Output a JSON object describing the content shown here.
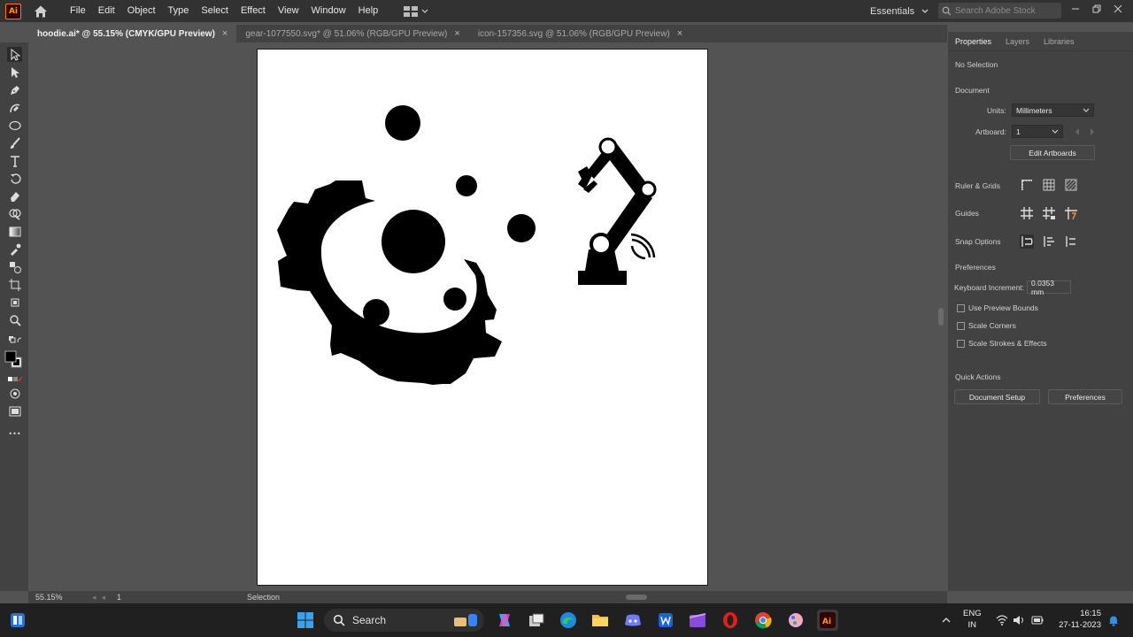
{
  "app": {
    "logo": "Ai",
    "brand_color": "#ff9a00"
  },
  "menu": {
    "items": [
      "File",
      "Edit",
      "Object",
      "Type",
      "Select",
      "Effect",
      "View",
      "Window",
      "Help"
    ],
    "workspace": "Essentials",
    "stock_search_placeholder": "Search Adobe Stock"
  },
  "tabs": [
    {
      "label": "hoodie.ai* @ 55.15% (CMYK/GPU Preview)",
      "active": true
    },
    {
      "label": "gear-1077550.svg* @ 51.06% (RGB/GPU Preview)",
      "active": false
    },
    {
      "label": "icon-157356.svg @ 51.06% (RGB/GPU Preview)",
      "active": false
    }
  ],
  "tab_close_glyph": "×",
  "toolbar": {
    "tools": [
      "selection-tool",
      "direct-selection-tool",
      "pen-tool",
      "curvature-tool",
      "ellipse-tool",
      "paintbrush-tool",
      "type-tool",
      "rotate-tool",
      "eraser-tool",
      "shape-builder-tool",
      "gradient-tool",
      "eyedropper-tool",
      "blend-tool",
      "artboard-tool",
      "zoom-tool"
    ],
    "more_glyph": "•••"
  },
  "status": {
    "zoom": "55.15%",
    "artboard": "1",
    "tool": "Selection"
  },
  "panel": {
    "tabs": [
      "Properties",
      "Layers",
      "Libraries"
    ],
    "selection": "No Selection",
    "document_heading": "Document",
    "units_label": "Units:",
    "units_value": "Millimeters",
    "artboard_label": "Artboard:",
    "artboard_value": "1",
    "edit_artboards": "Edit Artboards",
    "ruler_grids": "Ruler & Grids",
    "guides": "Guides",
    "snap_options": "Snap Options",
    "preferences_heading": "Preferences",
    "keyboard_increment_label": "Keyboard Increment:",
    "keyboard_increment_value": "0.0353 mm",
    "use_preview_bounds": "Use Preview Bounds",
    "scale_corners": "Scale Corners",
    "scale_strokes": "Scale Strokes & Effects",
    "quick_actions": "Quick Actions",
    "document_setup_button": "Document Setup",
    "preferences_button": "Preferences"
  },
  "taskbar": {
    "search_label": "Search",
    "lang_top": "ENG",
    "lang_bottom": "IN",
    "time": "16:15",
    "date": "27-11-2023"
  }
}
